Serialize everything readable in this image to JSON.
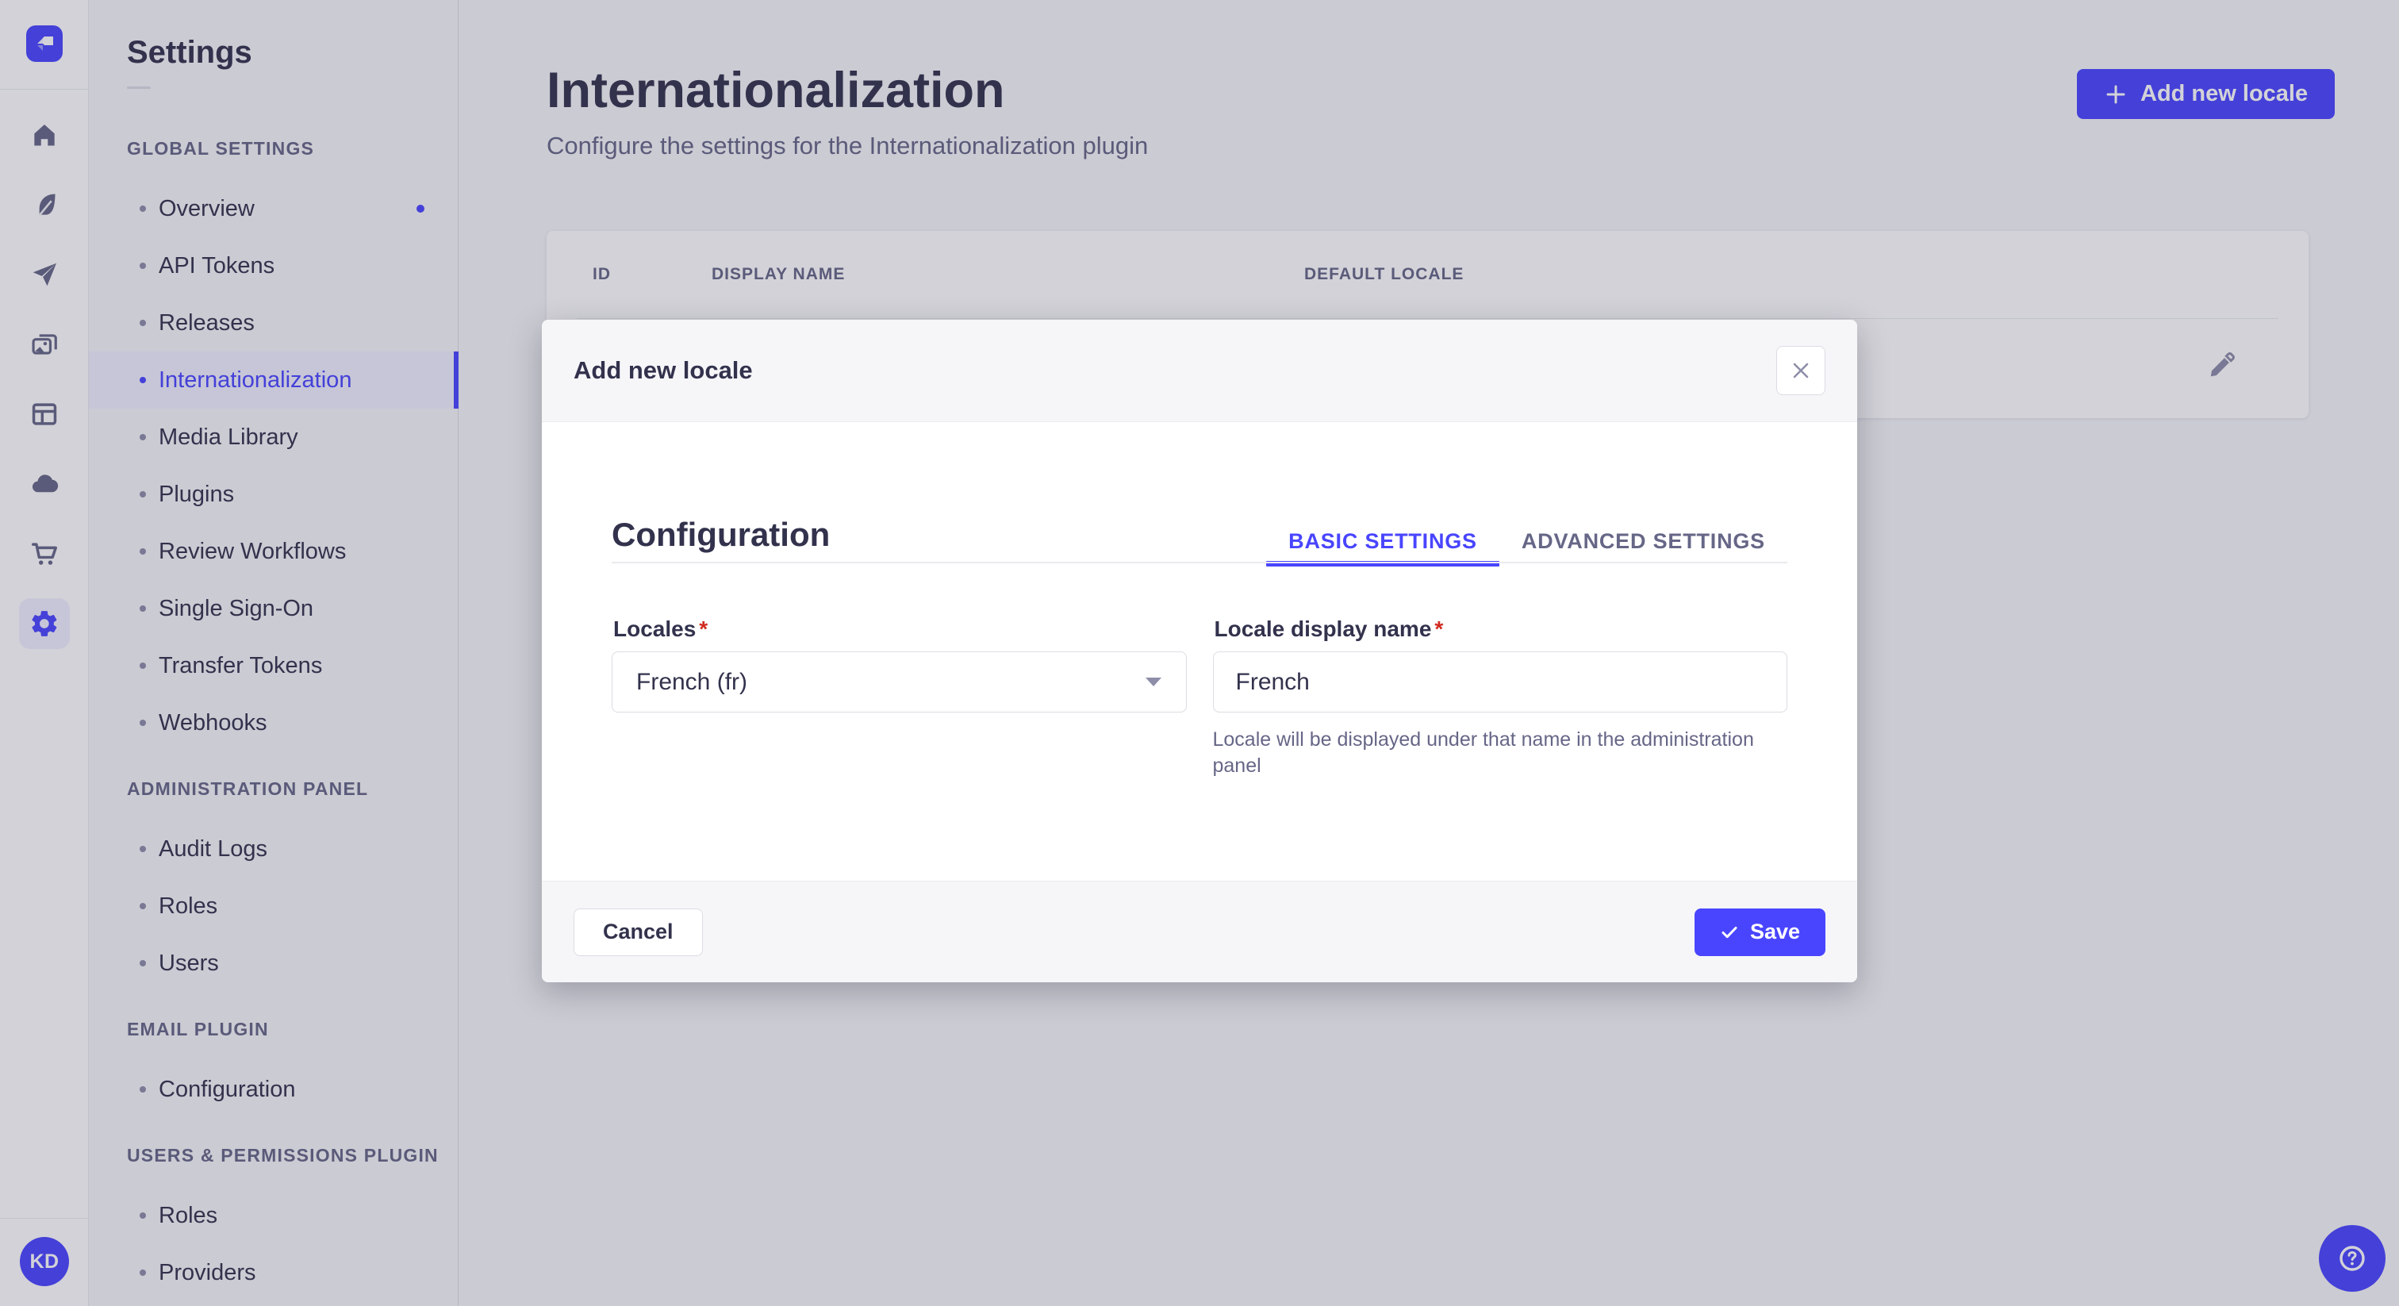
{
  "colors": {
    "primary": "#4945ff",
    "primary_light_bg": "#f0f0ff",
    "text_dark": "#32324d",
    "text_muted": "#666687",
    "danger": "#d02b20"
  },
  "rail": {
    "logo": "strapi-logo",
    "icons": [
      {
        "name": "home-icon",
        "glyph": "home"
      },
      {
        "name": "feather-icon",
        "glyph": "feather"
      },
      {
        "name": "paper-plane-icon",
        "glyph": "plane"
      },
      {
        "name": "media-library-icon",
        "glyph": "pictures"
      },
      {
        "name": "content-manager-icon",
        "glyph": "layout"
      },
      {
        "name": "cloud-icon",
        "glyph": "cloud"
      },
      {
        "name": "marketplace-cart-icon",
        "glyph": "cart"
      },
      {
        "name": "settings-gear-icon",
        "glyph": "gear",
        "active": true
      }
    ],
    "avatar_initials": "KD"
  },
  "settings_nav": {
    "title": "Settings",
    "sections": [
      {
        "label": "GLOBAL SETTINGS",
        "items": [
          {
            "label": "Overview",
            "notification": true
          },
          {
            "label": "API Tokens"
          },
          {
            "label": "Releases"
          },
          {
            "label": "Internationalization",
            "active": true
          },
          {
            "label": "Media Library"
          },
          {
            "label": "Plugins"
          },
          {
            "label": "Review Workflows"
          },
          {
            "label": "Single Sign-On"
          },
          {
            "label": "Transfer Tokens"
          },
          {
            "label": "Webhooks"
          }
        ]
      },
      {
        "label": "ADMINISTRATION PANEL",
        "items": [
          {
            "label": "Audit Logs"
          },
          {
            "label": "Roles"
          },
          {
            "label": "Users"
          }
        ]
      },
      {
        "label": "EMAIL PLUGIN",
        "items": [
          {
            "label": "Configuration"
          }
        ]
      },
      {
        "label": "USERS & PERMISSIONS PLUGIN",
        "items": [
          {
            "label": "Roles"
          },
          {
            "label": "Providers"
          }
        ]
      }
    ]
  },
  "main": {
    "title": "Internationalization",
    "subtitle": "Configure the settings for the Internationalization plugin",
    "add_button_label": "Add new locale",
    "table": {
      "headers": [
        "ID",
        "DISPLAY NAME",
        "DEFAULT LOCALE"
      ]
    }
  },
  "modal": {
    "title": "Add new locale",
    "section_title": "Configuration",
    "tabs": [
      {
        "label": "BASIC SETTINGS",
        "active": true
      },
      {
        "label": "ADVANCED SETTINGS"
      }
    ],
    "fields": {
      "locales": {
        "label": "Locales",
        "required": true,
        "value": "French (fr)"
      },
      "display_name": {
        "label": "Locale display name",
        "required": true,
        "value": "French",
        "hint": "Locale will be displayed under that name in the administration panel"
      }
    },
    "cancel_label": "Cancel",
    "save_label": "Save"
  }
}
